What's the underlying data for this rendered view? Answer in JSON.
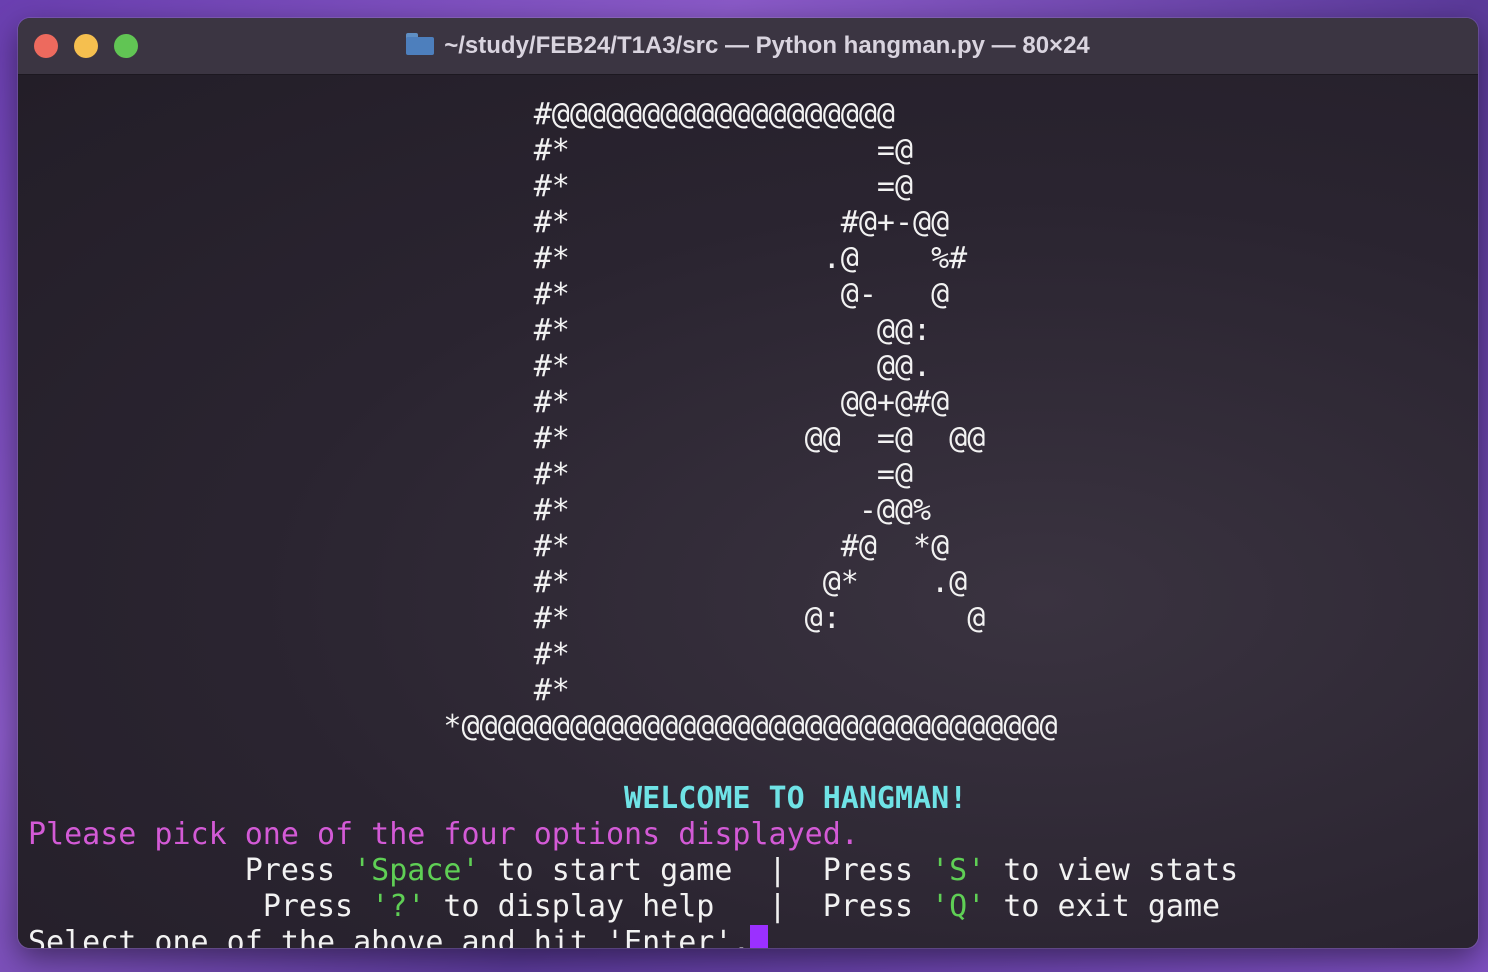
{
  "window": {
    "title": "~/study/FEB24/T1A3/src — Python hangman.py — 80×24"
  },
  "ascii_art": [
    "                            #@@@@@@@@@@@@@@@@@@@",
    "                            #*                 =@",
    "                            #*                 =@",
    "                            #*               #@+-@@",
    "                            #*              .@    %#",
    "                            #*               @-   @",
    "                            #*                 @@:",
    "                            #*                 @@.",
    "                            #*               @@+@#@",
    "                            #*             @@  =@  @@",
    "                            #*                 =@",
    "                            #*                -@@%",
    "                            #*               #@  *@",
    "                            #*              @*    .@",
    "                            #*             @:       @",
    "                            #*",
    "                            #*",
    "                       *@@@@@@@@@@@@@@@@@@@@@@@@@@@@@@@@@"
  ],
  "welcome": "WELCOME TO HANGMAN!",
  "welcome_indent": "                                 ",
  "instruction": "Please pick one of the four options displayed.",
  "options": {
    "row1": {
      "indent": "            ",
      "pre1": "Press ",
      "key1": "'Space'",
      "post1": " to start game  |  Press ",
      "key2": "'S'",
      "post2": " to view stats"
    },
    "row2": {
      "indent": "             ",
      "pre1": "Press ",
      "key1": "'?'",
      "post1": " to display help   |  Press ",
      "key2": "'Q'",
      "post2": " to exit game"
    }
  },
  "select_prompt": "Select one of the above and hit 'Enter'.",
  "colors": {
    "welcome": "#6fe3e6",
    "instruction": "#d35ad6",
    "key": "#5fcf55",
    "cursor": "#9b30ff"
  }
}
